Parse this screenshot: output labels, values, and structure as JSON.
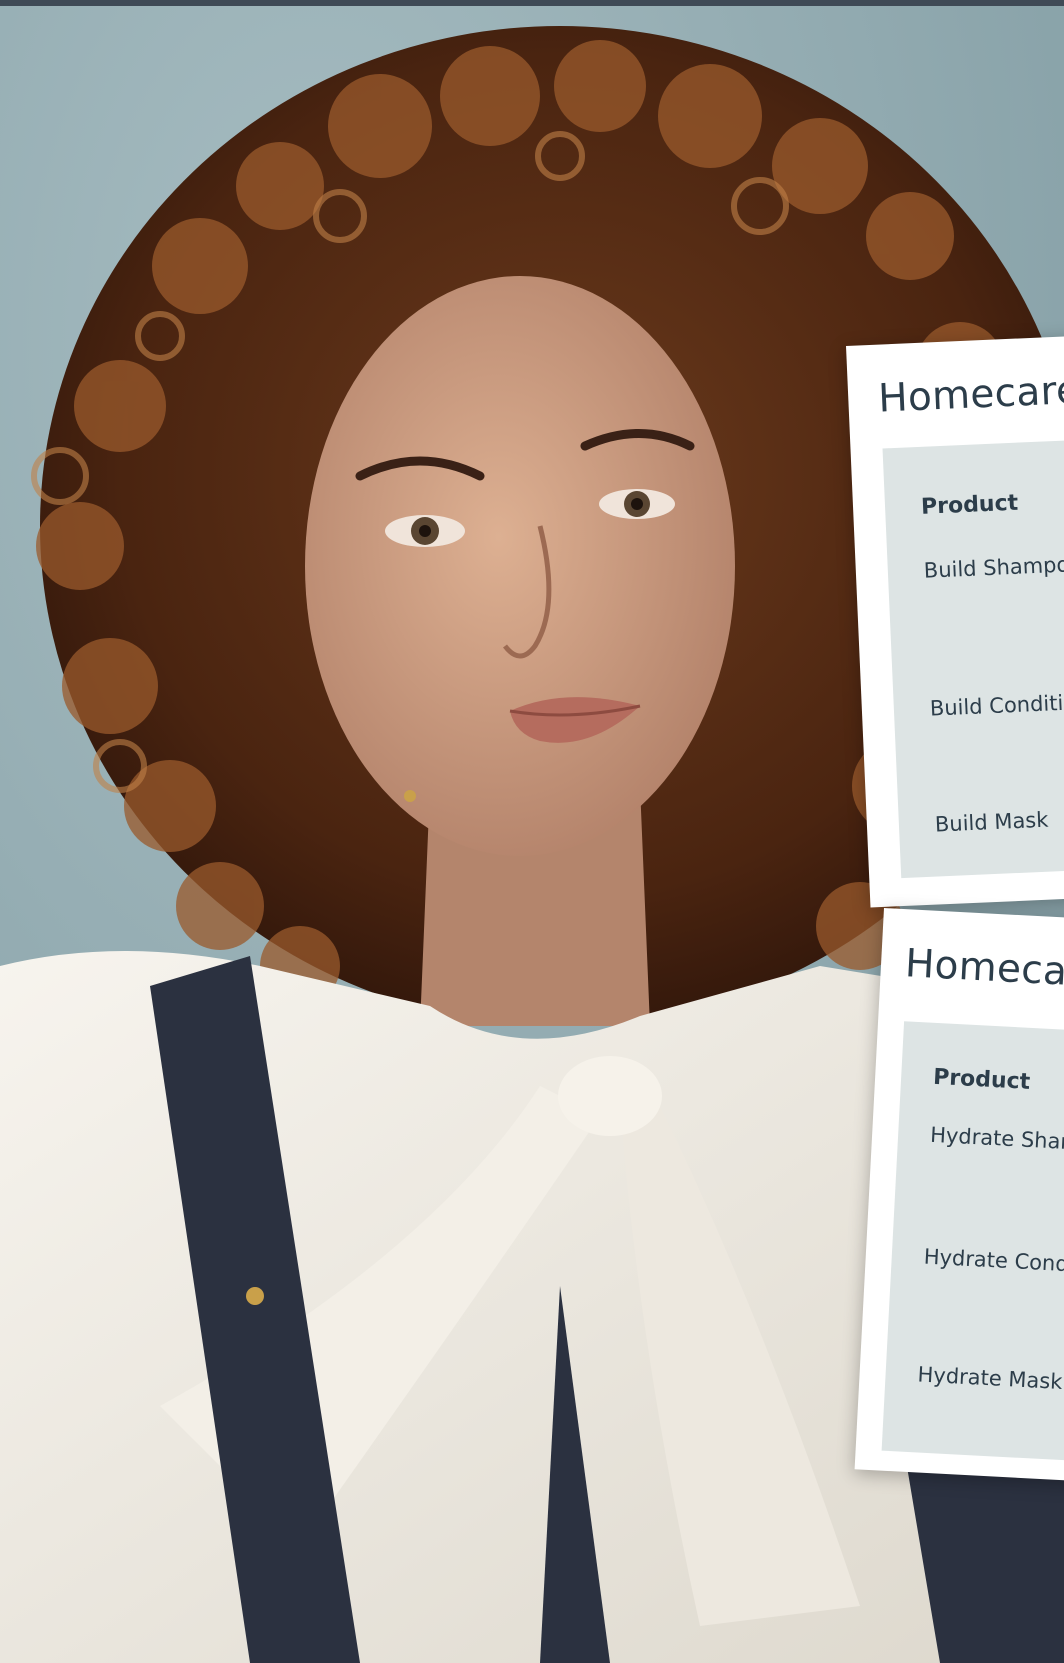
{
  "cards": [
    {
      "title": "Homecare",
      "column_header": "Product",
      "rows": [
        "Build Shampoo",
        "Build Conditioner",
        "Build Mask"
      ]
    },
    {
      "title": "Homecare",
      "column_header": "Product",
      "rows": [
        "Hydrate Shampoo",
        "Hydrate Conditioner",
        "Hydrate Mask"
      ]
    }
  ],
  "colors": {
    "backdrop": "#8fa9af",
    "top_bar": "#3f4a56",
    "card_background": "#ffffff",
    "panel_background": "#dde4e4",
    "text": "#2c3d4a"
  }
}
